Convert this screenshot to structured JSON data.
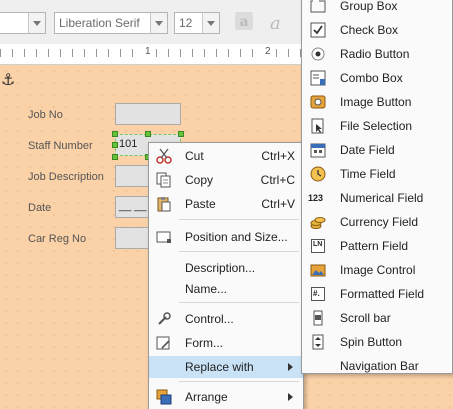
{
  "toolbar": {
    "style_value": "",
    "font_name": "Liberation Serif",
    "font_size": "12",
    "icons": [
      "sidebar-icon",
      "fontwork-icon",
      "italic-a-icon"
    ]
  },
  "ruler": {
    "numbers": [
      "1",
      "2"
    ]
  },
  "form": {
    "fields": [
      {
        "label": "Job No",
        "value": ""
      },
      {
        "label": "Staff Number",
        "value": "101"
      },
      {
        "label": "Job Description",
        "value": ""
      },
      {
        "label": "Date",
        "value": "__ __"
      },
      {
        "label": "Car Reg No",
        "value": ""
      }
    ]
  },
  "context_menu": {
    "cut": {
      "label": "Cut",
      "shortcut": "Ctrl+X"
    },
    "copy": {
      "label": "Copy",
      "shortcut": "Ctrl+C"
    },
    "paste": {
      "label": "Paste",
      "shortcut": "Ctrl+V"
    },
    "position_size": "Position and Size...",
    "description": "Description...",
    "name": "Name...",
    "control": "Control...",
    "form": "Form...",
    "replace_with": "Replace with",
    "arrange": "Arrange"
  },
  "submenu": {
    "items": [
      "Group Box",
      "Check Box",
      "Radio Button",
      "Combo Box",
      "Image Button",
      "File Selection",
      "Date Field",
      "Time Field",
      "Numerical Field",
      "Currency Field",
      "Pattern Field",
      "Image Control",
      "Formatted Field",
      "Scroll bar",
      "Spin Button",
      "Navigation Bar"
    ],
    "numerical_icon_text": "123",
    "pattern_icon_text": "LN",
    "formatted_icon_text": "#."
  },
  "colors": {
    "page": "#fbd2a8",
    "highlight": "#c9e2f6",
    "handles": "#65c23c"
  }
}
